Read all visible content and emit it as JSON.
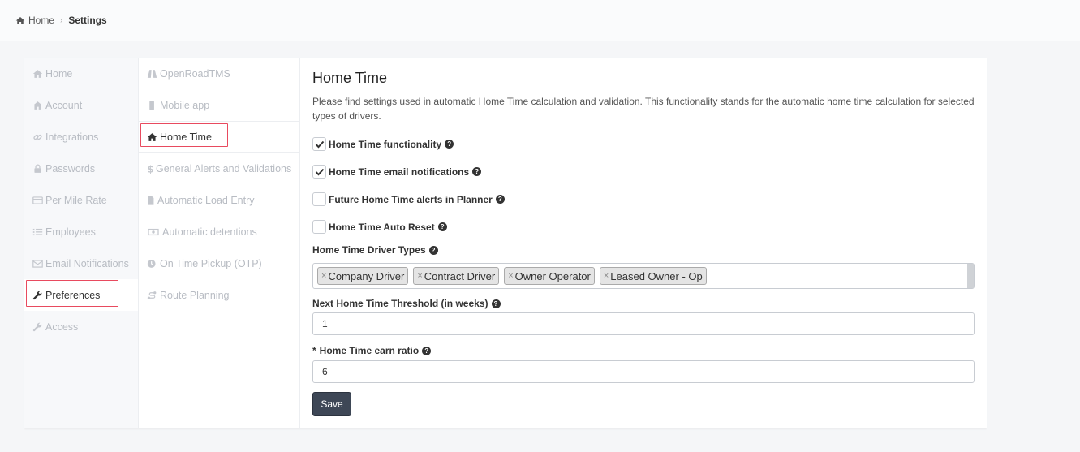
{
  "breadcrumb": {
    "home": "Home",
    "current": "Settings"
  },
  "nav_primary": [
    {
      "label": "Home",
      "icon": "home-icon"
    },
    {
      "label": "Account",
      "icon": "home-icon"
    },
    {
      "label": "Integrations",
      "icon": "link-icon"
    },
    {
      "label": "Passwords",
      "icon": "lock-icon"
    },
    {
      "label": "Per Mile Rate",
      "icon": "credit-card-icon"
    },
    {
      "label": "Employees",
      "icon": "list-icon"
    },
    {
      "label": "Email Notifications",
      "icon": "envelope-icon"
    },
    {
      "label": "Preferences",
      "icon": "wrench-icon",
      "active": true
    },
    {
      "label": "Access",
      "icon": "wrench-icon"
    }
  ],
  "nav_secondary": [
    {
      "label": "OpenRoadTMS",
      "icon": "road-icon"
    },
    {
      "label": "Mobile app",
      "icon": "mobile-icon"
    },
    {
      "label": "Home Time",
      "icon": "home-icon",
      "active": true
    },
    {
      "label": "General Alerts and Validations",
      "icon": "dollar-icon"
    },
    {
      "label": "Automatic Load Entry",
      "icon": "file-icon"
    },
    {
      "label": "Automatic detentions",
      "icon": "money-icon"
    },
    {
      "label": "On Time Pickup (OTP)",
      "icon": "clock-icon"
    },
    {
      "label": "Route Planning",
      "icon": "route-icon"
    }
  ],
  "main": {
    "title": "Home Time",
    "description": "Please find settings used in automatic Home Time calculation and validation. This functionality stands for the automatic home time calculation for selected types of drivers.",
    "checkboxes": [
      {
        "label": "Home Time functionality",
        "checked": true
      },
      {
        "label": "Home Time email notifications",
        "checked": true
      },
      {
        "label": "Future Home Time alerts in Planner",
        "checked": false
      },
      {
        "label": "Home Time Auto Reset",
        "checked": false
      }
    ],
    "driver_types_label": "Home Time Driver Types",
    "driver_types": [
      "Company Driver",
      "Contract Driver",
      "Owner Operator",
      "Leased Owner - Op"
    ],
    "threshold_label": "Next Home Time Threshold (in weeks)",
    "threshold_value": "1",
    "earn_ratio_required": "*",
    "earn_ratio_label": "Home Time earn ratio",
    "earn_ratio_value": "6",
    "save_label": "Save"
  },
  "colors": {
    "highlight": "#e84a5f",
    "save_button": "#3e4756",
    "nav_inactive": "#b8bcc3"
  }
}
